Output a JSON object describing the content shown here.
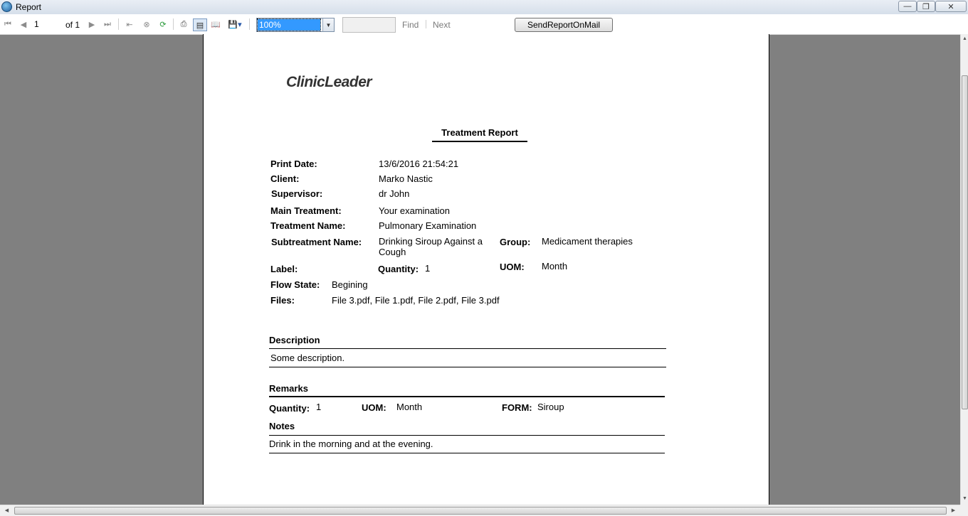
{
  "window": {
    "title": "Report"
  },
  "toolbar": {
    "page_number": "1",
    "page_of": "of 1",
    "zoom": "100%",
    "find_value": "",
    "find_label": "Find",
    "next_label": "Next",
    "send_mail_label": "SendReportOnMail"
  },
  "report": {
    "logo_text": "ClinicLeader",
    "title": "Treatment Report",
    "fields": {
      "print_date_label": "Print Date:",
      "print_date": "13/6/2016 21:54:21",
      "client_label": "Client:",
      "client": "Marko Nastic",
      "supervisor_label": "Supervisor:",
      "supervisor": "dr John",
      "main_treatment_label": "Main Treatment:",
      "main_treatment": "Your examination",
      "treatment_name_label": "Treatment Name:",
      "treatment_name": "Pulmonary Examination",
      "subtreatment_name_label": "Subtreatment Name:",
      "subtreatment_name_line1": "Drinking Siroup Against a",
      "subtreatment_name_line2": "Cough",
      "group_label": "Group:",
      "group": "Medicament therapies",
      "label_label": "Label:",
      "label": "",
      "quantity_label": "Quantity:",
      "quantity": "1",
      "uom_label": "UOM:",
      "uom": "Month",
      "flow_state_label": "Flow State:",
      "flow_state": "Begining",
      "files_label": "Files:",
      "files": "File 3.pdf, File 1.pdf, File 2.pdf, File 3.pdf"
    },
    "description": {
      "title": "Description",
      "text": "Some description."
    },
    "remarks": {
      "title": "Remarks",
      "quantity_label": "Quantity:",
      "quantity": "1",
      "uom_label": "UOM:",
      "uom": "Month",
      "form_label": "FORM:",
      "form": "Siroup"
    },
    "notes": {
      "title": "Notes",
      "text": "Drink in the morning and at the evening."
    }
  }
}
